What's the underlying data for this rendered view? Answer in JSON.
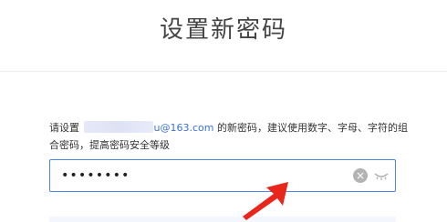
{
  "header": {
    "title": "设置新密码"
  },
  "instructions": {
    "prefix": "请设置",
    "email_visible": "u@163.com",
    "suffix": "的新密码，建议使用数字、字母、字符的组合密码，提高密码安全等级"
  },
  "password_field": {
    "value": "••••••••"
  },
  "icons": {
    "clear": "clear-icon",
    "toggle": "eye-closed-icon",
    "annotation": "red-arrow-annotation"
  },
  "colors": {
    "focus_border": "#4a86e8",
    "email_link": "#3b73d8",
    "arrow": "#e8261c"
  }
}
